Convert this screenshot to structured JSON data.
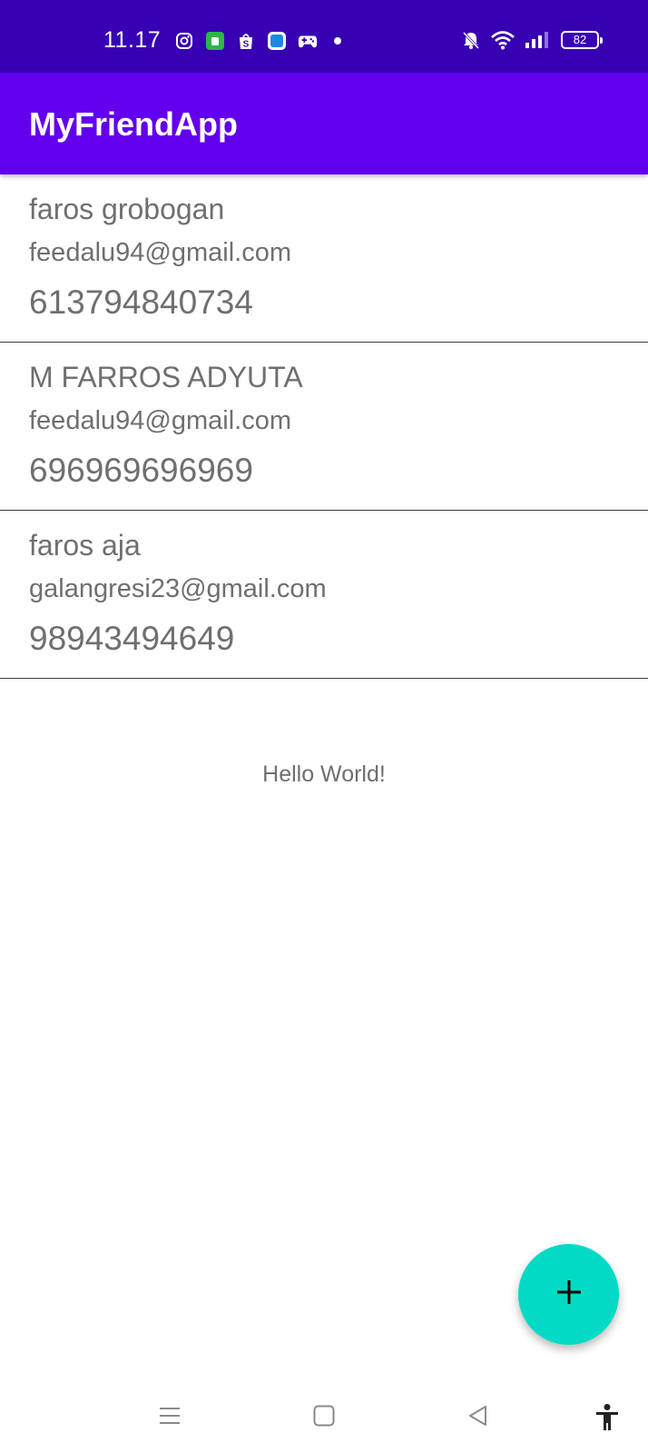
{
  "status_bar": {
    "time": "11.17",
    "notification_icons": [
      "instagram-icon",
      "tokopedia-icon",
      "shopee-icon",
      "app-icon",
      "gamepad-icon"
    ],
    "system_icons": [
      "bell-muted-icon",
      "wifi-icon",
      "signal-icon"
    ],
    "battery": "82"
  },
  "app_bar": {
    "title": "MyFriendApp",
    "color": "#6200ee"
  },
  "friends": [
    {
      "name": "faros grobogan",
      "email": "feedalu94@gmail.com",
      "phone": "613794840734"
    },
    {
      "name": "M FARROS ADYUTA",
      "email": "feedalu94@gmail.com",
      "phone": "696969696969"
    },
    {
      "name": "faros aja",
      "email": "galangresi23@gmail.com",
      "phone": "98943494649"
    }
  ],
  "hello_text": "Hello World!",
  "fab": {
    "icon": "plus-icon",
    "color": "#03dac5"
  },
  "nav_bar": {
    "buttons": [
      "menu-icon",
      "home-icon",
      "back-icon",
      "accessibility-icon"
    ]
  }
}
